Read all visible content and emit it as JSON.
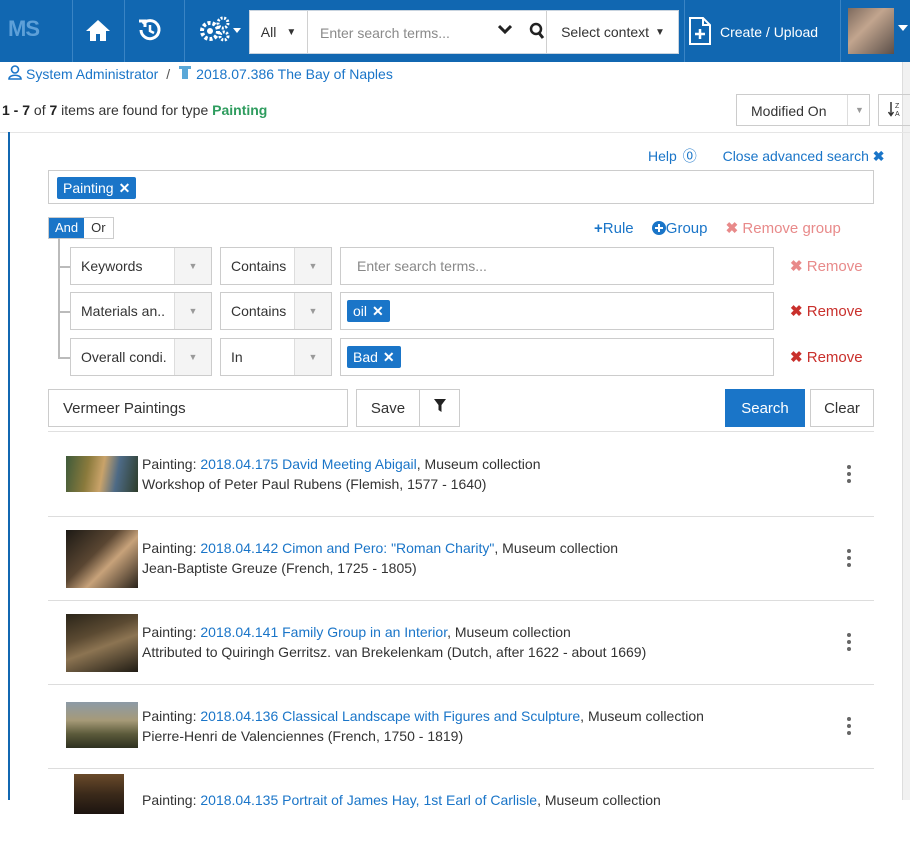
{
  "topbar": {
    "logo": "MS",
    "search_scope": "All",
    "search_placeholder": "Enter search terms...",
    "context_label": "Select context",
    "create_label": "Create / Upload"
  },
  "breadcrumb": {
    "user": "System Administrator",
    "separator": "/",
    "record": "2018.07.386 The Bay of Naples"
  },
  "results_header": {
    "range": "1 - 7",
    "of_word": " of ",
    "total": "7",
    "middle": " items are found for type ",
    "type": "Painting",
    "sort_label": "Modified On",
    "sort_dir_icon": "sort-az-icon"
  },
  "advanced": {
    "help_label": "Help",
    "close_label": "Close advanced search",
    "type_tag": "Painting",
    "and_label": "And",
    "or_label": "Or",
    "add_rule_label": "Rule",
    "add_group_label": "Group",
    "remove_group_label": "Remove group",
    "rules": [
      {
        "field": "Keywords",
        "operator": "Contains",
        "value_placeholder": "Enter search terms...",
        "value_tag": "",
        "remove_label": "Remove"
      },
      {
        "field": "Materials an..",
        "operator": "Contains",
        "value_placeholder": "",
        "value_tag": "oil",
        "remove_label": "Remove"
      },
      {
        "field": "Overall condi.",
        "operator": "In",
        "value_placeholder": "",
        "value_tag": "Bad",
        "remove_label": "Remove"
      }
    ],
    "saved_search_name": "Vermeer Paintings",
    "save_label": "Save",
    "search_label": "Search",
    "clear_label": "Clear"
  },
  "results": [
    {
      "prefix": "Painting: ",
      "link": "2018.04.175 David Meeting Abigail",
      "suffix": ", Museum collection",
      "artist": "Workshop of Peter Paul Rubens (Flemish, 1577 - 1640)"
    },
    {
      "prefix": "Painting: ",
      "link": "2018.04.142 Cimon and Pero: \"Roman Charity\"",
      "suffix": ", Museum collection",
      "artist": "Jean-Baptiste Greuze (French, 1725 - 1805)"
    },
    {
      "prefix": "Painting: ",
      "link": "2018.04.141 Family Group in an Interior",
      "suffix": ", Museum collection",
      "artist": "Attributed to Quiringh Gerritsz. van Brekelenkam (Dutch, after 1622 - about 1669)"
    },
    {
      "prefix": "Painting: ",
      "link": "2018.04.136 Classical Landscape with Figures and Sculpture",
      "suffix": ", Museum collection",
      "artist": "Pierre-Henri de Valenciennes (French, 1750 - 1819)"
    },
    {
      "prefix": "Painting: ",
      "link": "2018.04.135 Portrait of James Hay, 1st Earl of Carlisle",
      "suffix": ", Museum collection",
      "artist": ""
    }
  ],
  "colors": {
    "brand": "#1167b1",
    "link": "#1a75c8",
    "type_highlight": "#2e9c5e",
    "remove_active": "#c9302c"
  }
}
